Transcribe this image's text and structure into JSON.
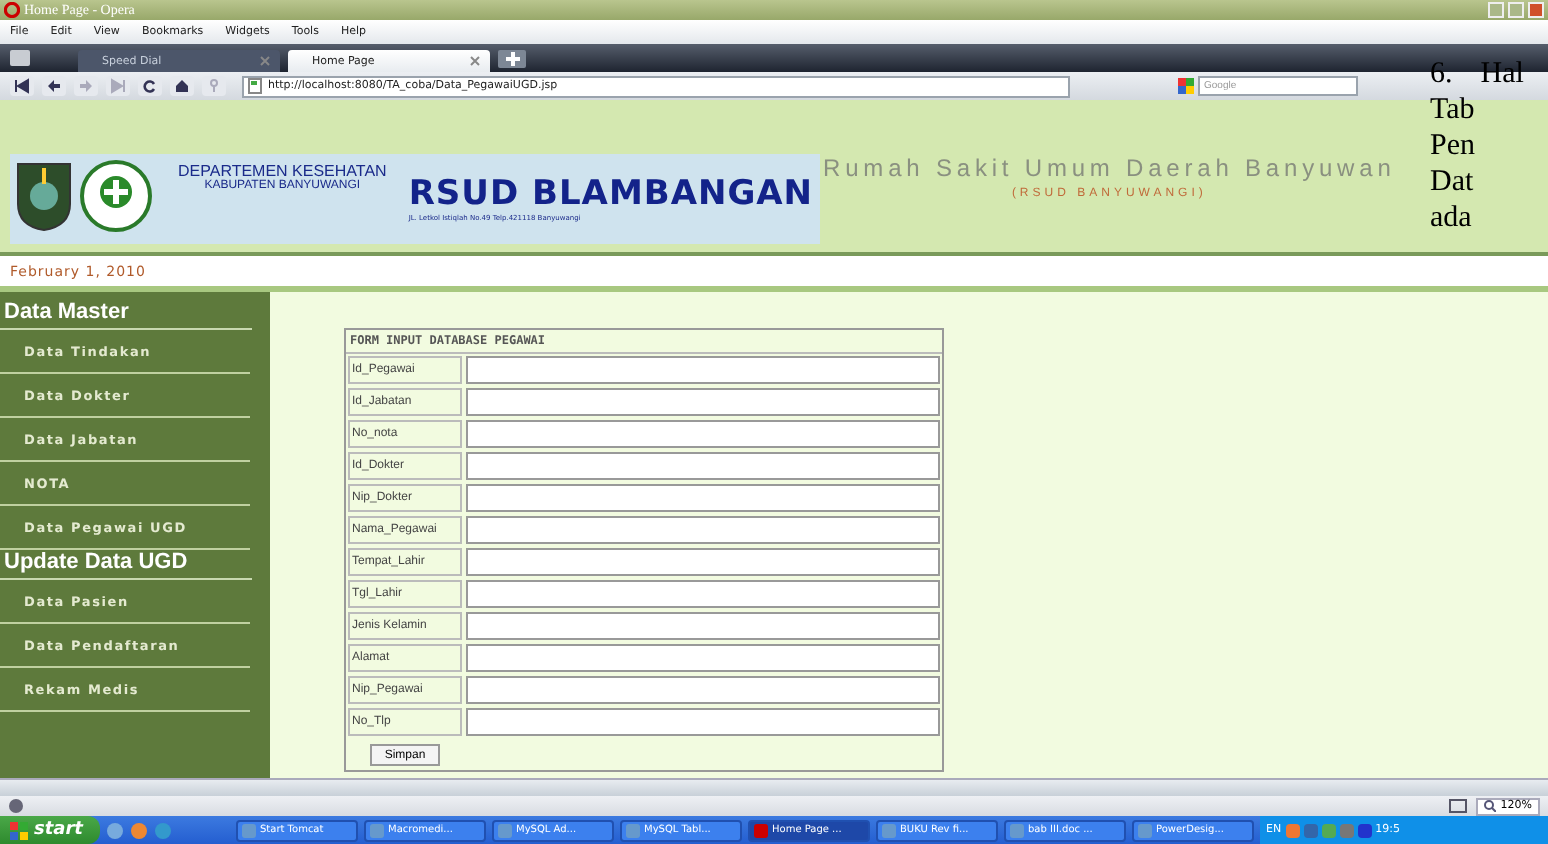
{
  "window": {
    "title": "Home Page - Opera"
  },
  "menu": [
    "File",
    "Edit",
    "View",
    "Bookmarks",
    "Widgets",
    "Tools",
    "Help"
  ],
  "tabs": [
    {
      "label": "Speed Dial",
      "selected": false
    },
    {
      "label": "Home Page",
      "selected": true
    }
  ],
  "address_bar": {
    "url": "http://localhost:8080/TA_coba/Data_PegawaiUGD.jsp"
  },
  "search": {
    "placeholder": "Google"
  },
  "banner": {
    "department": "DEPARTEMEN KESEHATAN",
    "regency": "KABUPATEN BANYUWANGI",
    "hospital_name": "RSUD BLAMBANGAN",
    "address": "JL. Letkol Istiqlah No.49 Telp.421118 Banyuwangi",
    "title": "Rumah Sakit Umum Daerah Banyuwan",
    "subtitle": "(RSUD BANYUWANGI)"
  },
  "date": "February 1, 2010",
  "sidebar": {
    "sections": [
      {
        "heading": "Data Master",
        "items": [
          "Data Tindakan",
          "Data Dokter",
          "Data Jabatan",
          "NOTA",
          "Data Pegawai UGD"
        ]
      },
      {
        "heading": "Update Data UGD",
        "items": [
          "Data Pasien",
          "Data Pendaftaran",
          "Rekam Medis"
        ]
      }
    ]
  },
  "form": {
    "title": "FORM INPUT DATABASE PEGAWAI",
    "fields": [
      "Id_Pegawai",
      "Id_Jabatan",
      "No_nota",
      "Id_Dokter",
      "Nip_Dokter",
      "Nama_Pegawai",
      "Tempat_Lahir",
      "Tgl_Lahir",
      "Jenis Kelamin",
      "Alamat",
      "Nip_Pegawai",
      "No_Tlp"
    ],
    "submit": "Simpan"
  },
  "status_bar": {
    "zoom": "120%"
  },
  "taskbar": {
    "start": "start",
    "items": [
      {
        "label": "Start Tomcat",
        "selected": false
      },
      {
        "label": "Macromedi...",
        "selected": false
      },
      {
        "label": "MySQL Ad...",
        "selected": false
      },
      {
        "label": "MySQL Tabl...",
        "selected": false
      },
      {
        "label": "Home Page ...",
        "selected": true
      },
      {
        "label": "BUKU Rev fi...",
        "selected": false
      },
      {
        "label": "bab III.doc ...",
        "selected": false
      },
      {
        "label": "PowerDesig...",
        "selected": false
      }
    ],
    "language": "EN",
    "clock": "19:5"
  },
  "overlay_text": [
    "6.",
    "Hal",
    "Tab",
    "Pen",
    "Dat",
    "ada"
  ]
}
